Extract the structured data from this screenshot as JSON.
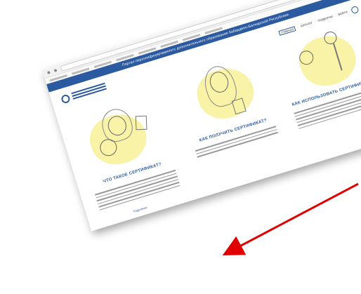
{
  "banner_text": "Портал персонифицированного дополнительного образования Кабардино-Балкарской Республики",
  "nav": [
    "ГЛАВНАЯ",
    "КАТАЛОГ",
    "ПОДБОРКИ",
    "ВОЙТИ"
  ],
  "columns": [
    {
      "heading": "ЧТО ТАКОЕ СЕРТИФИКАТ?",
      "more": "Подробнее"
    },
    {
      "heading": "КАК ПОЛУЧИТЬ СЕРТИФИКАТ?"
    },
    {
      "heading": "КАК ИСПОЛЬЗОВАТЬ СЕРТИФИКАТ?"
    }
  ],
  "cta_label": "ПОЛУЧИТЬ СЕРТИФИКАТ",
  "colors": {
    "brand": "#2c5aa0",
    "arrow": "#e00000",
    "highlight": "#f8f3a6"
  }
}
